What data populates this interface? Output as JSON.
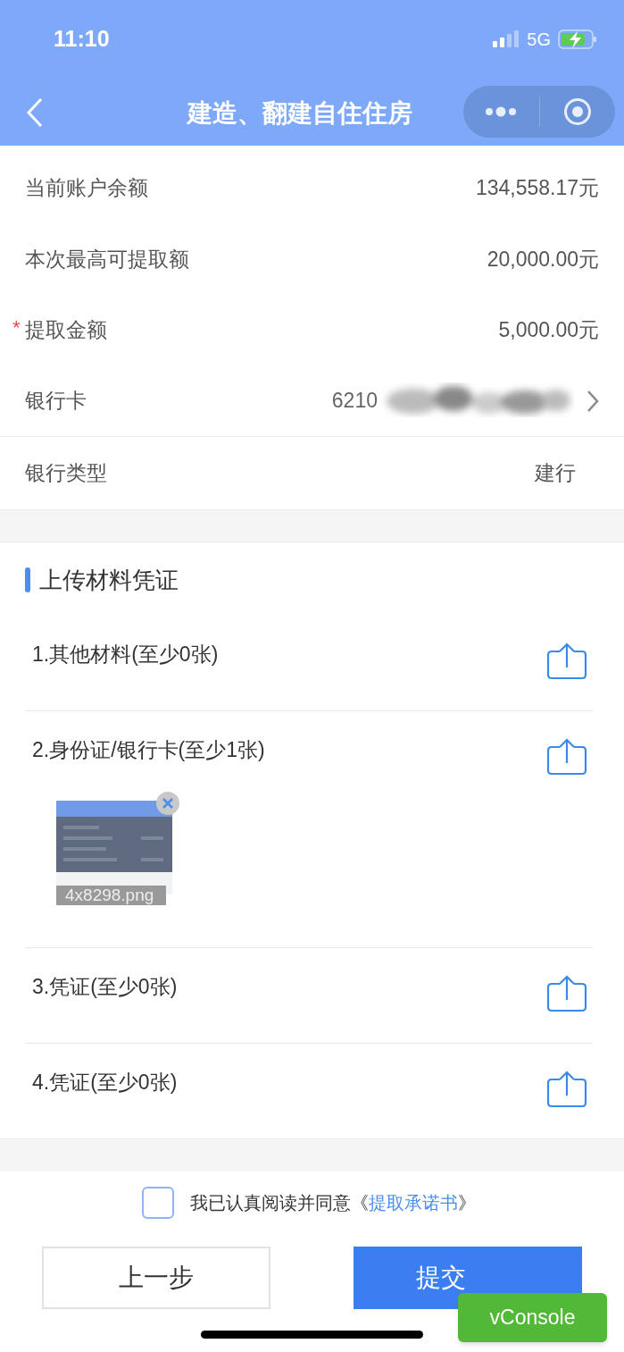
{
  "status_bar": {
    "time": "11:10",
    "network": "5G"
  },
  "nav": {
    "title": "建造、翻建自住住房"
  },
  "info_rows": [
    {
      "label": "当前账户余额",
      "value": "134,558.17元",
      "kind": "text"
    },
    {
      "label": "本次最高可提取额",
      "value": "20,000.00元",
      "kind": "text"
    },
    {
      "label": "提取金额",
      "value": "5,000.00元",
      "required_mark": "*",
      "kind": "text"
    },
    {
      "label": "银行卡",
      "value": "6210",
      "kind": "select"
    },
    {
      "label": "银行类型",
      "value": "建行",
      "kind": "text"
    }
  ],
  "upload": {
    "title": "上传材料凭证",
    "items": [
      {
        "label": "1.其他材料(至少0张)"
      },
      {
        "label": "2.身份证/银行卡(至少1张)",
        "files": [
          {
            "filename": "4x8298.png"
          }
        ]
      },
      {
        "label": "3.凭证(至少0张)"
      },
      {
        "label": "4.凭证(至少0张)"
      }
    ]
  },
  "agreement": {
    "checked": false,
    "text": "我已认真阅读并同意《",
    "link": "提取承诺书",
    "suffix": "》"
  },
  "buttons": [
    {
      "label": "上一步",
      "kind": "secondary"
    },
    {
      "label": "提交",
      "kind": "primary"
    }
  ],
  "vconsole": {
    "label": "vConsole"
  }
}
